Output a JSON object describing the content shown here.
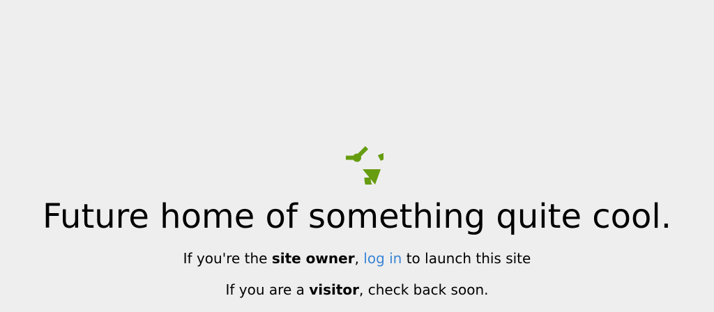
{
  "logo": {
    "icon": "clock-refresh-icon",
    "color": "#669c0f"
  },
  "headline": "Future home of something quite cool.",
  "owner_line": {
    "prefix": "If you're the ",
    "bold": "site owner",
    "comma": ", ",
    "link": "log in",
    "suffix": " to launch this site"
  },
  "visitor_line": {
    "prefix": "If you are a ",
    "bold": "visitor",
    "suffix": ", check back soon."
  },
  "colors": {
    "background": "#eeeeee",
    "link": "#3a85d4",
    "accent": "#669c0f"
  }
}
